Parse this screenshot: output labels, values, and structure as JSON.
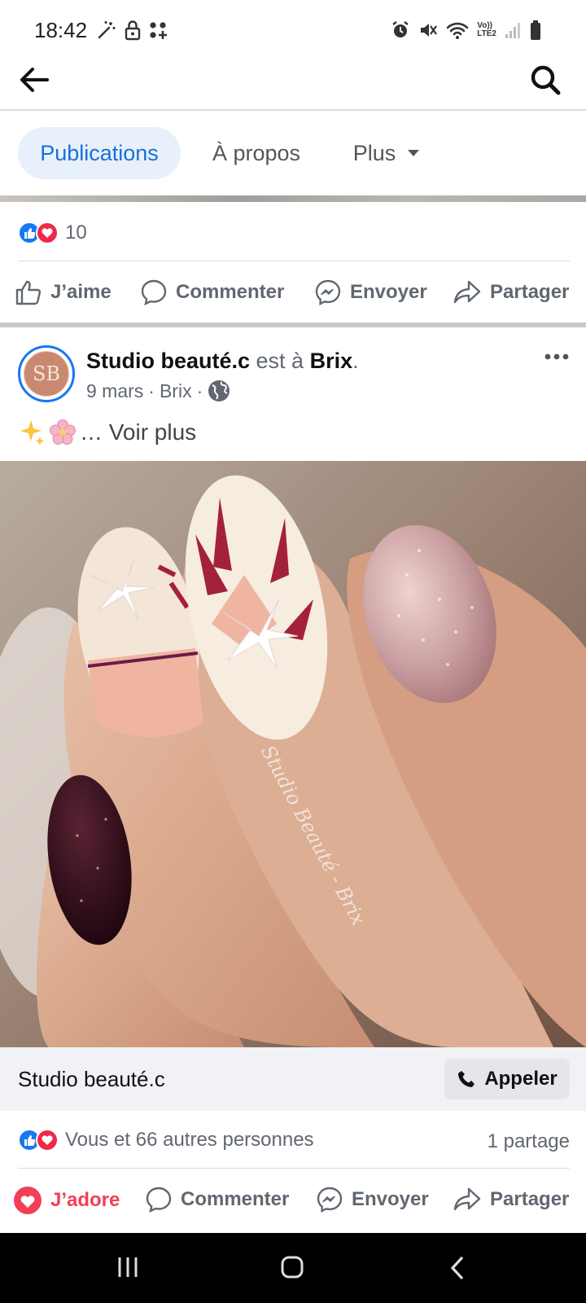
{
  "status_bar": {
    "time": "18:42",
    "network_label_top": "Vo))",
    "network_label_bottom": "LTE2"
  },
  "tabs": [
    {
      "label": "Publications",
      "active": true
    },
    {
      "label": "À propos",
      "active": false
    },
    {
      "label": "Plus",
      "active": false
    }
  ],
  "previous_post": {
    "reaction_count": "10",
    "actions": {
      "like": "J’aime",
      "comment": "Commenter",
      "send": "Envoyer",
      "share": "Partager"
    }
  },
  "post": {
    "avatar_initials": "SB",
    "page_name": "Studio beauté.c",
    "is_at": " est à ",
    "location": "Brix",
    "location_dot": ".",
    "date": "9 mars",
    "meta_location": "Brix",
    "meta_sep": "·",
    "caption_more": "… Voir plus",
    "photo_watermark": "Studio Beauté - Brix",
    "cta_name": "Studio beauté.c",
    "call_label": "Appeler",
    "reactions_text": "Vous et 66 autres personnes",
    "shares": "1 partage",
    "actions": {
      "love": "J’adore",
      "comment": "Commenter",
      "send": "Envoyer",
      "share": "Partager"
    }
  },
  "colors": {
    "brand_blue": "#1877f2",
    "love_red": "#f33e58",
    "avatar_ring": "#1877f2",
    "avatar_fill": "#c98970"
  }
}
